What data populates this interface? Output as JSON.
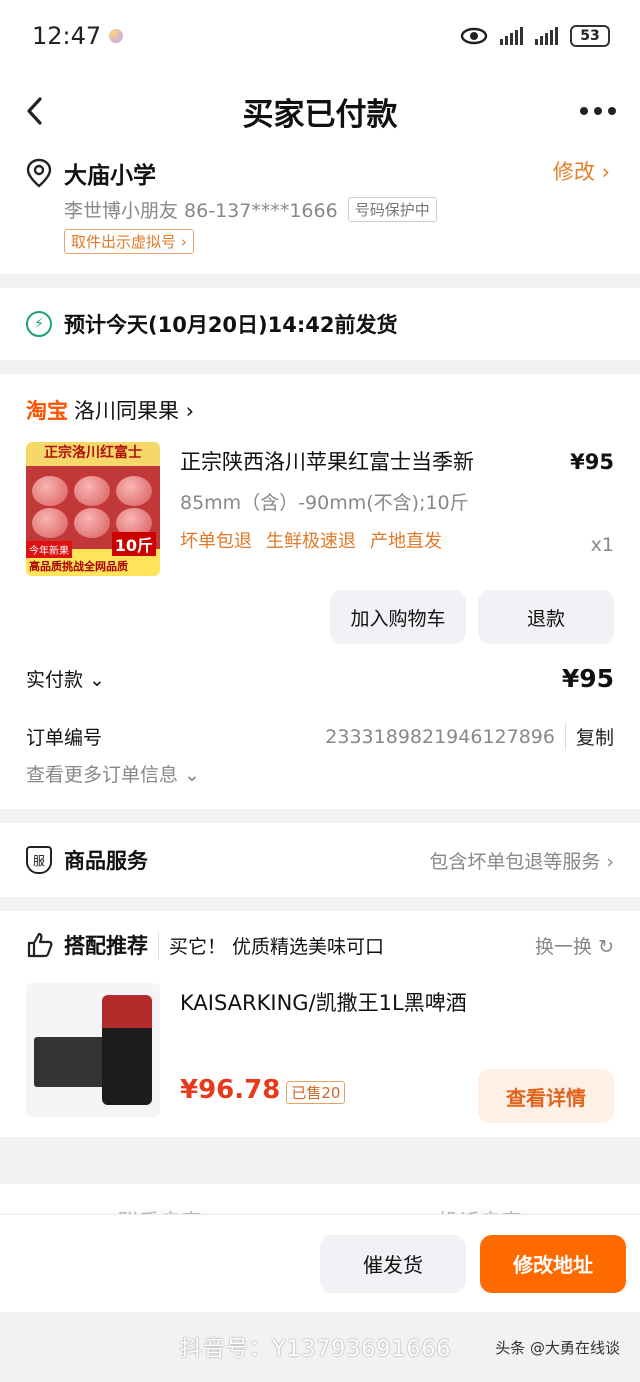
{
  "status_bar": {
    "time": "12:47",
    "battery": "53"
  },
  "nav": {
    "title": "买家已付款"
  },
  "address": {
    "name": "大庙小学",
    "edit_label": "修改 ›",
    "contact": "李世博小朋友 86-137****1666",
    "privacy_tag": "号码保护中",
    "virtual_tag": "取件出示虚拟号 ›"
  },
  "shipping": {
    "text": "预计今天(10月20日)14:42前发货"
  },
  "order": {
    "platform": "淘宝",
    "shop_name": "洛川同果果 ›",
    "product": {
      "image_top_text": "正宗洛川红富士",
      "image_badge_new": "今年新果",
      "image_badge_weight": "10斤",
      "image_bottom_text": "高品质挑战全网品质",
      "name": "正宗陕西洛川苹果红富士当季新",
      "spec": "85mm（含）-90mm(不含);10斤",
      "tags": [
        "坏单包退",
        "生鲜极速退",
        "产地直发"
      ],
      "price": "¥95",
      "qty": "x1"
    },
    "add_cart_label": "加入购物车",
    "refund_label": "退款",
    "paid_label": "实付款 ⌄",
    "paid_amount": "¥95",
    "order_no_label": "订单编号",
    "order_no": "2333189821946127896",
    "copy_label": "复制",
    "more_info_label": "查看更多订单信息 ⌄"
  },
  "service": {
    "title": "商品服务",
    "icon_text": "服",
    "desc": "包含坏单包退等服务 ›"
  },
  "recommend": {
    "title": "搭配推荐",
    "subtitle": "买它！ 优质精选美味可口",
    "swap_label": "换一换 ↻",
    "item": {
      "name": "KAISARKING/凯撒王1L黑啤酒",
      "price": "¥96.78",
      "sold": "已售20",
      "detail_label": "查看详情"
    }
  },
  "contact_peek": {
    "left": "联系卖家",
    "right": "投诉卖家"
  },
  "bottom": {
    "urge_label": "催发货",
    "change_addr_label": "修改地址"
  },
  "footer": {
    "watermark": "抖音号：Y13793691666",
    "source": "头条 @大勇在线谈"
  },
  "colors": {
    "accent": "#ff6a00",
    "taobao": "#ff5000",
    "tag_orange": "#e07a2a",
    "price_red": "#e63a1a"
  }
}
